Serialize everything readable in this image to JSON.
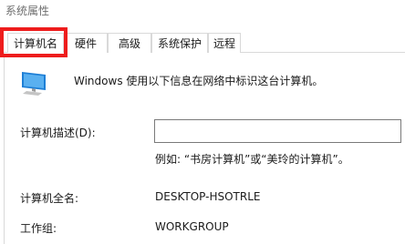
{
  "window": {
    "title": "系统属性"
  },
  "tabs": [
    {
      "label": "计算机名",
      "selected": true
    },
    {
      "label": "硬件",
      "selected": false
    },
    {
      "label": "高级",
      "selected": false
    },
    {
      "label": "系统保护",
      "selected": false
    },
    {
      "label": "远程",
      "selected": false
    }
  ],
  "icons": {
    "computer": "computer-monitor-icon"
  },
  "colors": {
    "highlight_border": "#ee1c1c",
    "tab_border": "#d9d9d9"
  },
  "computer_name_page": {
    "info_text": "Windows 使用以下信息在网络中标识这台计算机。",
    "description_label": "计算机描述(D):",
    "description_value": "",
    "description_placeholder": "",
    "example_text": "例如: “书房计算机”或“美玲的计算机”。",
    "full_name_label": "计算机全名:",
    "full_name_value": "DESKTOP-HSOTRLE",
    "workgroup_label": "工作组:",
    "workgroup_value": "WORKGROUP"
  }
}
